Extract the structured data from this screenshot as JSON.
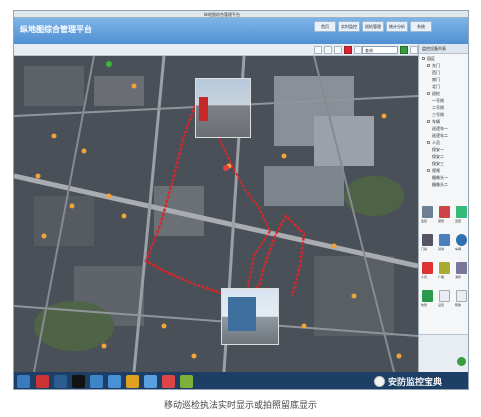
{
  "window": {
    "title": "纵地图综合管理平台"
  },
  "app": {
    "title": "纵地图综合管理平台"
  },
  "menu": [
    "首页",
    "实时监控",
    "巡检管理",
    "统计分析",
    "系统"
  ],
  "toolbar": {
    "search_value": "查询"
  },
  "sidebar": {
    "header": "监控设备列表",
    "tree": [
      "园区",
      "东门",
      "西门",
      "南门",
      "北门",
      "巡检",
      "一号岗",
      "二号岗",
      "三号岗",
      "车辆",
      "巡逻车一",
      "巡逻车二",
      "人员",
      "保安一",
      "保安二",
      "保安三",
      "视频",
      "摄像头一",
      "摄像头二"
    ],
    "icons": [
      "监控",
      "报警",
      "巡更",
      "门禁",
      "对讲",
      "车辆",
      "人员",
      "广播",
      "消防",
      "告警",
      "设置",
      "帮助"
    ]
  },
  "watermark": {
    "text": "安防监控宝典"
  },
  "caption": "移动巡检执法实时显示或拍照留底显示",
  "colors": {
    "route": "#d8262a",
    "poi": "#f2a33a",
    "brand_blue": "#4f8fd2"
  }
}
